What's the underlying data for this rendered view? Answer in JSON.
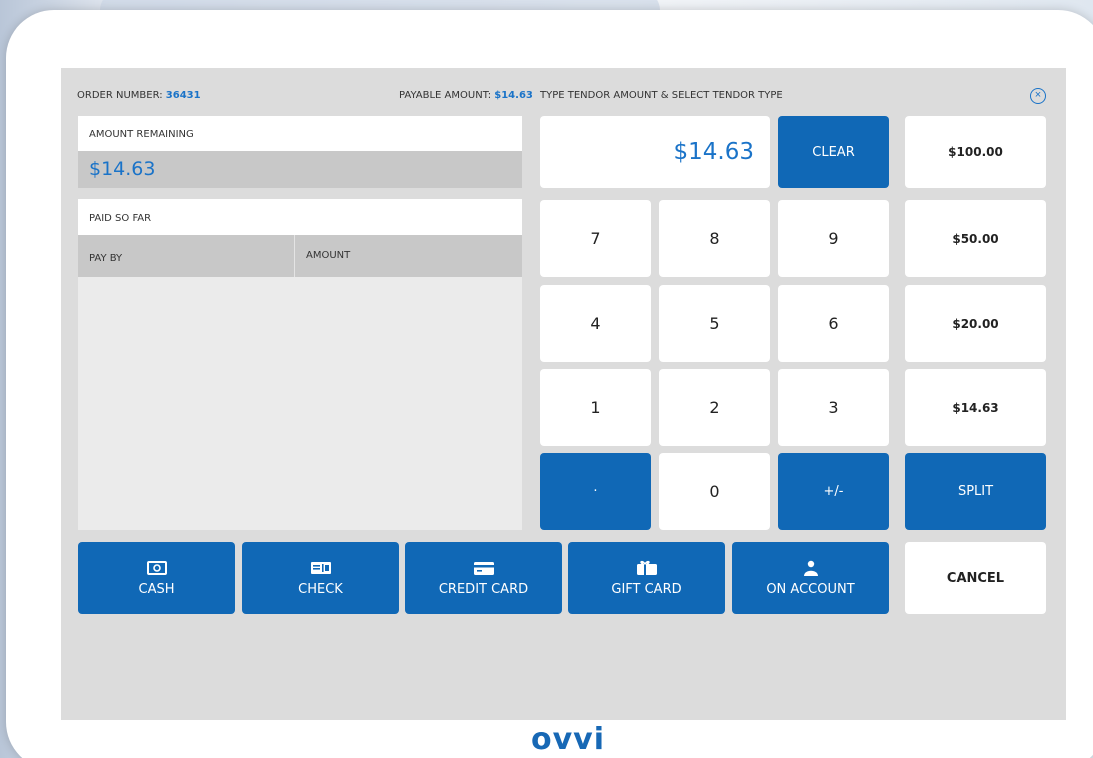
{
  "header": {
    "order_label": "ORDER NUMBER:",
    "order_number": "36431",
    "payable_label": "PAYABLE AMOUNT:",
    "payable_amount": "$14.63",
    "instruction": "TYPE TENDOR AMOUNT & SELECT TENDOR TYPE"
  },
  "remaining": {
    "label": "AMOUNT REMAINING",
    "value": "$14.63"
  },
  "paid": {
    "label": "PAID SO FAR",
    "col_pay_by": "PAY BY",
    "col_amount": "AMOUNT"
  },
  "keypad": {
    "display": "$14.63",
    "clear": "CLEAR",
    "keys": [
      "7",
      "8",
      "9",
      "4",
      "5",
      "6",
      "1",
      "2",
      "3",
      "·",
      "0",
      "+/-"
    ],
    "quick": [
      "$100.00",
      "$50.00",
      "$20.00",
      "$14.63"
    ],
    "split": "SPLIT",
    "cancel": "CANCEL"
  },
  "tenders": [
    "CASH",
    "CHECK",
    "CREDIT CARD",
    "GIFT CARD",
    "ON ACCOUNT"
  ],
  "brand": "ovvi",
  "colors": {
    "accent": "#1068b6",
    "screen_bg": "#dcdcdc",
    "link": "#1a73c8"
  }
}
